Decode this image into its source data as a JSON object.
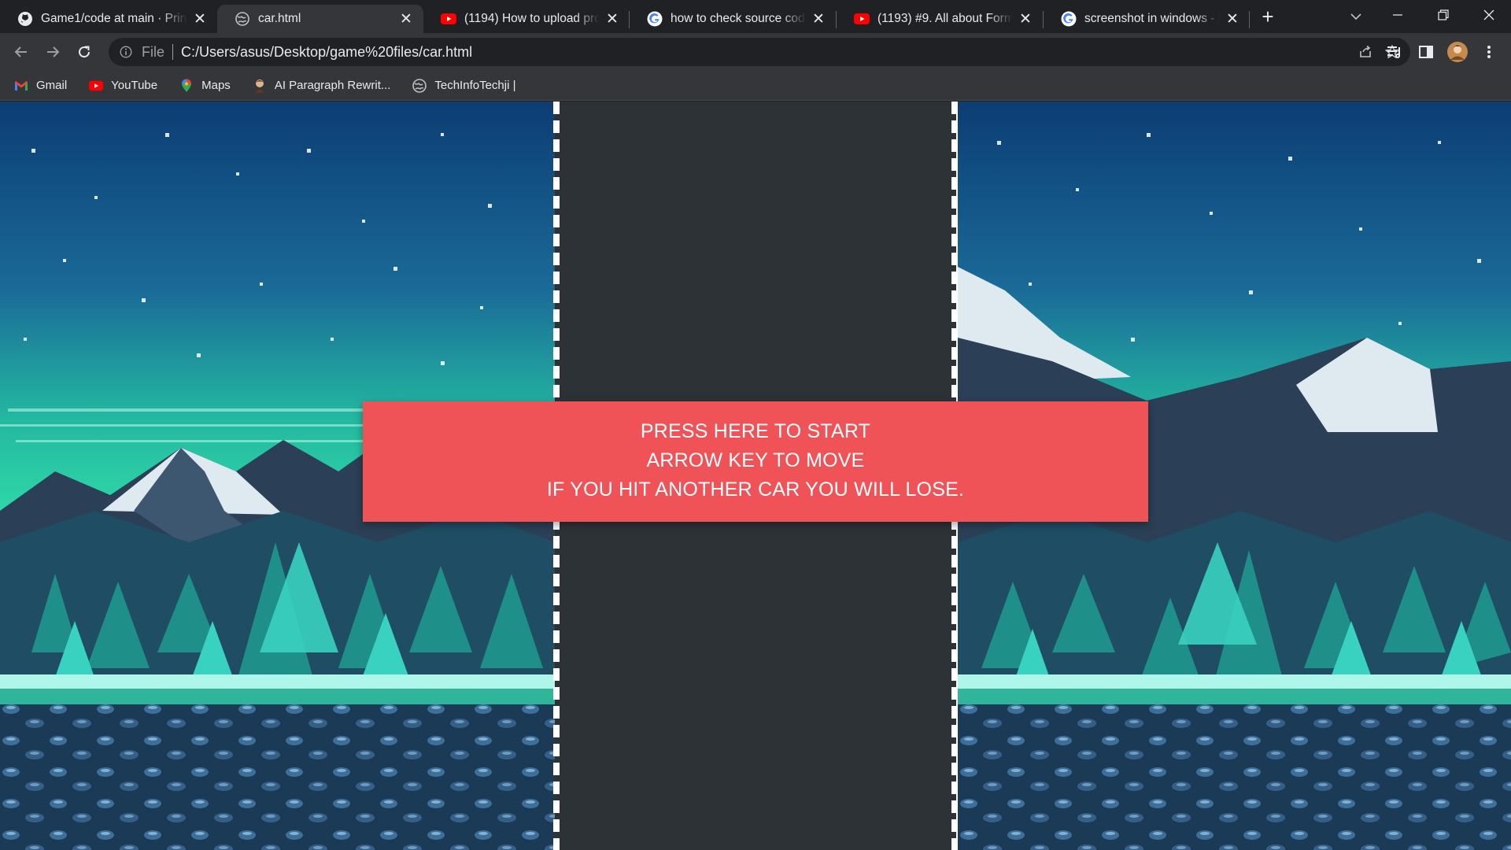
{
  "browser": {
    "tabs": [
      {
        "title": "Game1/code at main · Princ",
        "favicon": "github-icon",
        "active": false
      },
      {
        "title": "car.html",
        "favicon": "globe-icon",
        "active": true
      },
      {
        "title": "(1194) How to upload proje",
        "favicon": "youtube-icon",
        "active": false
      },
      {
        "title": "how to check source code c",
        "favicon": "google-icon",
        "active": false
      },
      {
        "title": "(1193) #9. All about Forms",
        "favicon": "youtube-icon",
        "active": false
      },
      {
        "title": "screenshot in windows - Go",
        "favicon": "google-icon",
        "active": false
      }
    ],
    "close_glyph": "✕",
    "new_tab_glyph": "+",
    "address": {
      "scheme_label": "File",
      "url": "C:/Users/asus/Desktop/game%20files/car.html"
    },
    "bookmarks": [
      {
        "label": "Gmail",
        "icon": "gmail-icon"
      },
      {
        "label": "YouTube",
        "icon": "youtube-icon"
      },
      {
        "label": "Maps",
        "icon": "maps-icon"
      },
      {
        "label": "AI Paragraph Rewrit...",
        "icon": "avatar-icon"
      },
      {
        "label": "TechInfoTechji |",
        "icon": "globe-icon"
      }
    ]
  },
  "game": {
    "start_lines": [
      "PRESS HERE TO START",
      "ARROW KEY TO MOVE",
      "IF YOU HIT ANOTHER CAR YOU WILL LOSE."
    ],
    "colors": {
      "start_box": "#ef5257",
      "road": "#2d3236",
      "lane_marks": "#ffffff"
    }
  }
}
